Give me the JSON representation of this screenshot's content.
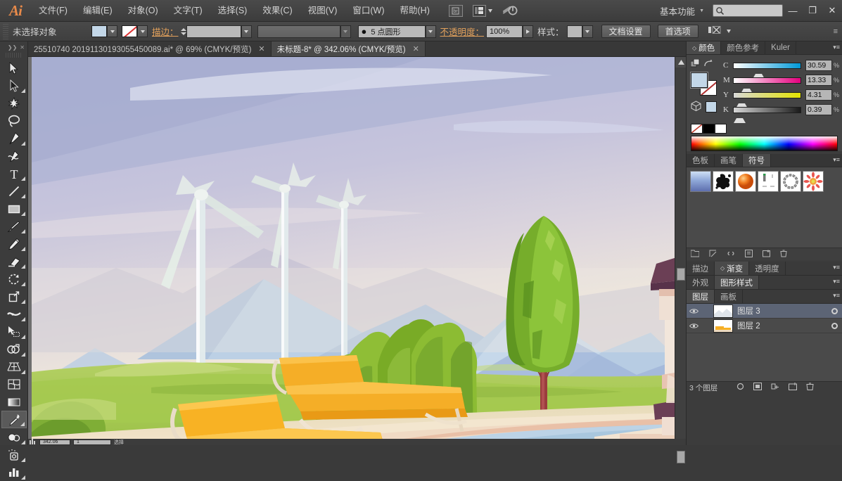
{
  "app": {
    "name": "Adobe Illustrator",
    "logo": "Ai"
  },
  "menubar": {
    "items": [
      {
        "label": "文件(F)",
        "name": "menu-file"
      },
      {
        "label": "编辑(E)",
        "name": "menu-edit"
      },
      {
        "label": "对象(O)",
        "name": "menu-object"
      },
      {
        "label": "文字(T)",
        "name": "menu-type"
      },
      {
        "label": "选择(S)",
        "name": "menu-select"
      },
      {
        "label": "效果(C)",
        "name": "menu-effect"
      },
      {
        "label": "视图(V)",
        "name": "menu-view"
      },
      {
        "label": "窗口(W)",
        "name": "menu-window"
      },
      {
        "label": "帮助(H)",
        "name": "menu-help"
      }
    ],
    "bridge_icon": "bridge-icon",
    "arrange_icon": "arrange-documents-icon",
    "cloud_icon": "cloud-sync-icon",
    "workspace": "基本功能",
    "search_placeholder": "",
    "search_value": "",
    "minimize": "—",
    "restore": "❐",
    "close": "✕"
  },
  "controlbar": {
    "selection_label": "未选择对象",
    "fill_color": "#c3d7e8",
    "stroke_label": "描边：",
    "stroke_weight_value": "",
    "stroke_profile_value": "",
    "brush_label": "",
    "brush_value": "5 点圆形",
    "opacity_label": "不透明度：",
    "opacity_value": "100%",
    "style_label": "样式：",
    "doc_setup_button": "文档设置",
    "preferences_button": "首选项",
    "align_icon": "align-objects-icon"
  },
  "tabs": [
    {
      "label": "25510740 20191130193055450089.ai* @ 69% (CMYK/预览)",
      "active": false,
      "close": "✕"
    },
    {
      "label": "未标题-8* @ 342.06% (CMYK/预览)",
      "active": true,
      "close": "✕"
    }
  ],
  "toolbar": {
    "tools": [
      {
        "name": "selection-tool",
        "label": "选择工具",
        "flyout": false,
        "selected": false
      },
      {
        "name": "direct-selection-tool",
        "label": "直接选择工具",
        "flyout": true,
        "selected": false
      },
      {
        "name": "magic-wand-tool",
        "label": "魔棒工具",
        "flyout": false,
        "selected": false
      },
      {
        "name": "lasso-tool",
        "label": "套索工具",
        "flyout": false,
        "selected": false
      },
      {
        "name": "pen-tool",
        "label": "钢笔工具",
        "flyout": true,
        "selected": false
      },
      {
        "name": "curvature-tool",
        "label": "曲率工具",
        "flyout": false,
        "selected": false
      },
      {
        "name": "type-tool",
        "label": "文字工具",
        "flyout": true,
        "selected": false
      },
      {
        "name": "line-segment-tool",
        "label": "直线段工具",
        "flyout": true,
        "selected": false
      },
      {
        "name": "rectangle-tool",
        "label": "矩形工具",
        "flyout": true,
        "selected": false
      },
      {
        "name": "paintbrush-tool",
        "label": "画笔工具",
        "flyout": true,
        "selected": false
      },
      {
        "name": "pencil-tool",
        "label": "铅笔工具",
        "flyout": true,
        "selected": false
      },
      {
        "name": "eraser-tool",
        "label": "橡皮擦工具",
        "flyout": true,
        "selected": false
      },
      {
        "name": "rotate-tool",
        "label": "旋转工具",
        "flyout": true,
        "selected": false
      },
      {
        "name": "scale-tool",
        "label": "比例缩放工具",
        "flyout": true,
        "selected": false
      },
      {
        "name": "width-tool",
        "label": "宽度工具",
        "flyout": true,
        "selected": false
      },
      {
        "name": "free-transform-tool",
        "label": "自由变换工具",
        "flyout": false,
        "selected": false
      },
      {
        "name": "shape-builder-tool",
        "label": "形状生成器工具",
        "flyout": true,
        "selected": false
      },
      {
        "name": "perspective-grid-tool",
        "label": "透视网格工具",
        "flyout": true,
        "selected": false
      },
      {
        "name": "mesh-tool",
        "label": "网格工具",
        "flyout": false,
        "selected": false
      },
      {
        "name": "gradient-tool",
        "label": "渐变工具",
        "flyout": false,
        "selected": false
      },
      {
        "name": "eyedropper-tool",
        "label": "吸管工具",
        "flyout": true,
        "selected": true
      },
      {
        "name": "blend-tool",
        "label": "混合工具",
        "flyout": true,
        "selected": false
      },
      {
        "name": "symbol-sprayer-tool",
        "label": "符号喷枪工具",
        "flyout": true,
        "selected": false
      },
      {
        "name": "column-graph-tool",
        "label": "柱形图工具",
        "flyout": true,
        "selected": false
      }
    ]
  },
  "color_panel": {
    "tabs": [
      {
        "label": "颜色",
        "active": true
      },
      {
        "label": "颜色参考",
        "active": false
      },
      {
        "label": "Kuler",
        "active": false
      }
    ],
    "mode": "CMYK",
    "channels": [
      {
        "label": "C",
        "value": "30.59",
        "unit": "%",
        "pos": 30.59
      },
      {
        "label": "M",
        "value": "13.33",
        "unit": "%",
        "pos": 13.33
      },
      {
        "label": "Y",
        "value": "4.31",
        "unit": "%",
        "pos": 4.31
      },
      {
        "label": "K",
        "value": "0.39",
        "unit": "%",
        "pos": 0.39
      }
    ],
    "fill_color": "#c3d7e8",
    "stroke_color": "#ffffff",
    "none_swatch": "none-swatch",
    "black_swatch": "#000000",
    "white_swatch": "#ffffff"
  },
  "swatch_panel": {
    "tabs": [
      {
        "label": "色板",
        "active": false
      },
      {
        "label": "画笔",
        "active": false
      },
      {
        "label": "符号",
        "active": true
      }
    ],
    "symbols": [
      {
        "name": "symbol-gradient-sky"
      },
      {
        "name": "symbol-ink-splat"
      },
      {
        "name": "symbol-orange-sphere"
      },
      {
        "name": "symbol-ruler-guides"
      },
      {
        "name": "symbol-rope-ring"
      },
      {
        "name": "symbol-red-flower"
      }
    ],
    "footer_icons": [
      "symbol-libraries-icon",
      "place-symbol-instance-icon",
      "break-link-icon",
      "symbol-options-icon",
      "new-symbol-icon",
      "delete-symbol-icon"
    ]
  },
  "stroke_panel": {
    "tabs": [
      {
        "label": "描边",
        "active": false
      },
      {
        "label": "渐变",
        "active": true
      },
      {
        "label": "透明度",
        "active": false
      }
    ]
  },
  "appearance_panel": {
    "tabs": [
      {
        "label": "外观",
        "active": false
      },
      {
        "label": "图形样式",
        "active": true
      }
    ]
  },
  "layers_panel": {
    "tabs": [
      {
        "label": "图层",
        "active": true
      },
      {
        "label": "画板",
        "active": false
      }
    ],
    "rows": [
      {
        "name": "图层 3",
        "selected": true,
        "visible": true,
        "locked": false
      },
      {
        "name": "图层 2",
        "selected": false,
        "visible": true,
        "locked": false
      }
    ],
    "footer_count": "3 个图层",
    "footer_icons": [
      "locate-object-icon",
      "make-clipping-mask-icon",
      "create-new-sublayer-icon",
      "create-new-layer-icon",
      "delete-layer-icon"
    ]
  },
  "statusbar": {
    "zoom_value": "342.06",
    "artboard_value": "1",
    "tool_text": "选择"
  },
  "artwork": {
    "title": "风力发电机与泳池风景插画",
    "description": "扁平风格矢量插画：淡紫蓝天空、远山、三座白色风力发电机、绿色树丛、一棵高大的柏树、草地、橙黄色躺椅、泳池与右侧别墅屋檐",
    "colors": {
      "sky_top": "#b9bedd",
      "sky_bottom": "#f2eadf",
      "mountain_far": "#a8b6d8",
      "mountain_blue": "#aec6e0",
      "grass_light": "#b7d36a",
      "grass_mid": "#9cc44f",
      "tree_green": "#77ad2e",
      "tree_dark": "#5f9624",
      "chair_orange": "#f5a623",
      "chair_orange_dark": "#e8931a",
      "pool_blue": "#b7cfe2",
      "deck_sand": "#ecdcc3",
      "roof_purple": "#6b3f55"
    }
  }
}
